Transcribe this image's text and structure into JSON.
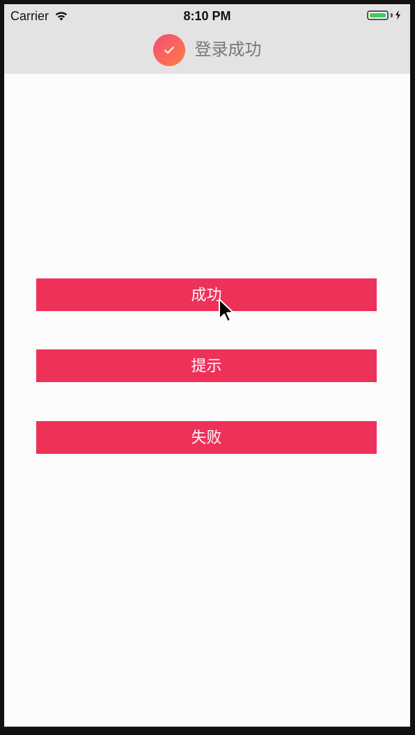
{
  "status_bar": {
    "carrier": "Carrier",
    "time": "8:10 PM",
    "wifi_icon": "wifi-icon",
    "battery_icon": "battery-full-icon",
    "charging_icon": "charging-bolt-icon",
    "battery_level": 1.0,
    "battery_color": "#43c85a"
  },
  "toast": {
    "icon": "check-circle-icon",
    "message": "登录成功",
    "icon_gradient": [
      "#f44b75",
      "#ff7e45"
    ],
    "text_color": "#777777",
    "background": "#e3e3e3"
  },
  "buttons": {
    "success_label": "成功",
    "info_label": "提示",
    "error_label": "失败",
    "color": "#ee3159",
    "text_color": "#fbfbfb"
  },
  "cursor": {
    "icon": "mouse-pointer-icon"
  }
}
